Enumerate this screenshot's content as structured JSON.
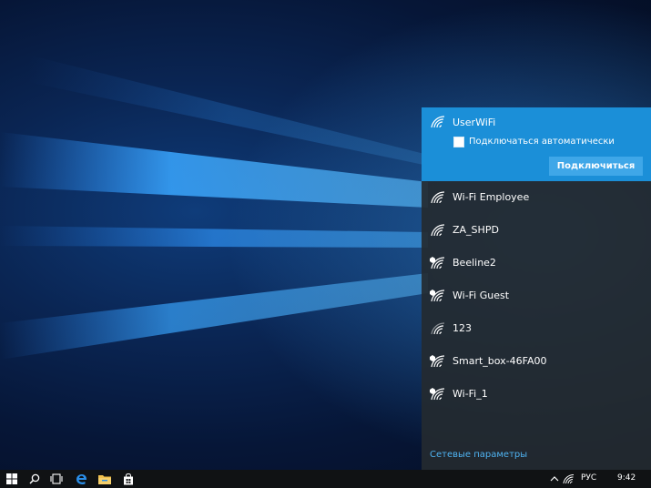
{
  "flyout": {
    "selected_network": {
      "name": "UserWiFi",
      "auto_connect_label": "Подключаться автоматически",
      "auto_connect_checked": false,
      "connect_label": "Подключиться",
      "secured": false
    },
    "networks": [
      {
        "name": "Wi-Fi Employee",
        "secured": false
      },
      {
        "name": "ZA_SHPD",
        "secured": false
      },
      {
        "name": "Beeline2",
        "secured": true
      },
      {
        "name": "Wi-Fi Guest",
        "secured": true
      },
      {
        "name": "123",
        "secured": false
      },
      {
        "name": "Smart_box-46FA00",
        "secured": true
      },
      {
        "name": "Wi-Fi_1",
        "secured": true
      }
    ],
    "settings_link": "Сетевые параметры"
  },
  "taskbar": {
    "language": "РУС",
    "time": "9:42",
    "icons": [
      "windows-start-icon",
      "search-icon",
      "task-view-icon",
      "edge-icon",
      "file-explorer-icon",
      "store-icon"
    ],
    "tray_icons": [
      "chevron-up-icon",
      "wifi-icon",
      "volume-icon"
    ]
  },
  "colors": {
    "accent": "#1b8fd8",
    "button": "#3fa7e8",
    "link": "#4fb3f1",
    "flyout_bg": "#242a30",
    "taskbar_bg": "#101214"
  }
}
